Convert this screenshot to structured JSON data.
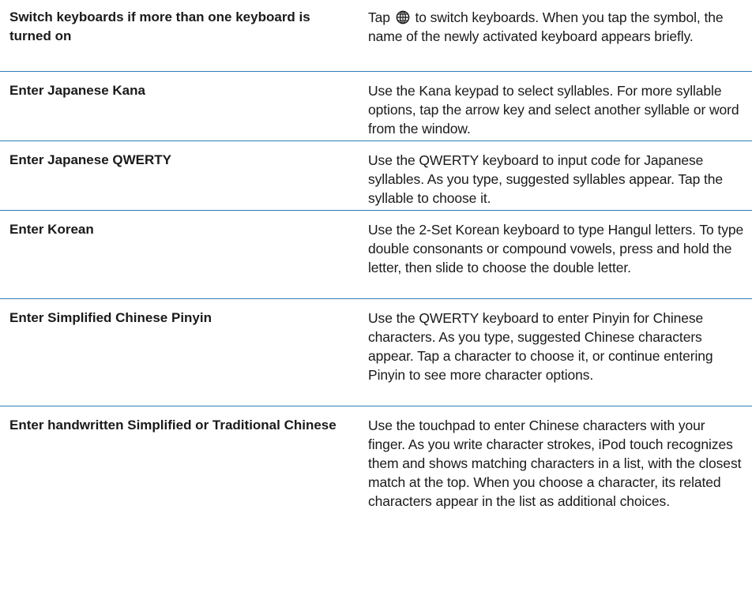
{
  "rows": [
    {
      "task": "Switch keyboards if more than one keyboard is turned on",
      "howto_before_icon": "Tap",
      "icon": "globe-icon",
      "howto_after_icon": "to switch keyboards. When you tap the symbol, the name of the newly activated keyboard appears briefly."
    },
    {
      "task": "Enter Japanese Kana",
      "howto": "Use the Kana keypad to select syllables. For more syllable options, tap the arrow key and select another syllable or word from the window."
    },
    {
      "task": "Enter Japanese QWERTY",
      "howto": "Use the QWERTY keyboard to input code for Japanese syllables. As you type, suggested syllables appear. Tap the syllable to choose it."
    },
    {
      "task": "Enter Korean",
      "howto": "Use the 2-Set Korean keyboard to type Hangul letters. To type double consonants or compound vowels, press and hold the letter, then slide to choose the double letter."
    },
    {
      "task": "Enter Simplified Chinese Pinyin",
      "howto": "Use the QWERTY keyboard to enter Pinyin for Chinese characters. As you type, suggested Chinese characters appear. Tap a character to choose it, or continue entering Pinyin to see more character options."
    },
    {
      "task": "Enter handwritten Simplified or Traditional Chinese",
      "howto": "Use the touchpad to enter Chinese characters with your finger. As you write character strokes, iPod touch recognizes them and shows matching characters in a list, with the closest match at the top. When you choose a character, its related characters appear in the list as additional choices."
    }
  ],
  "colors": {
    "divider": "#2e7fb8",
    "text": "#1a1a1a"
  }
}
